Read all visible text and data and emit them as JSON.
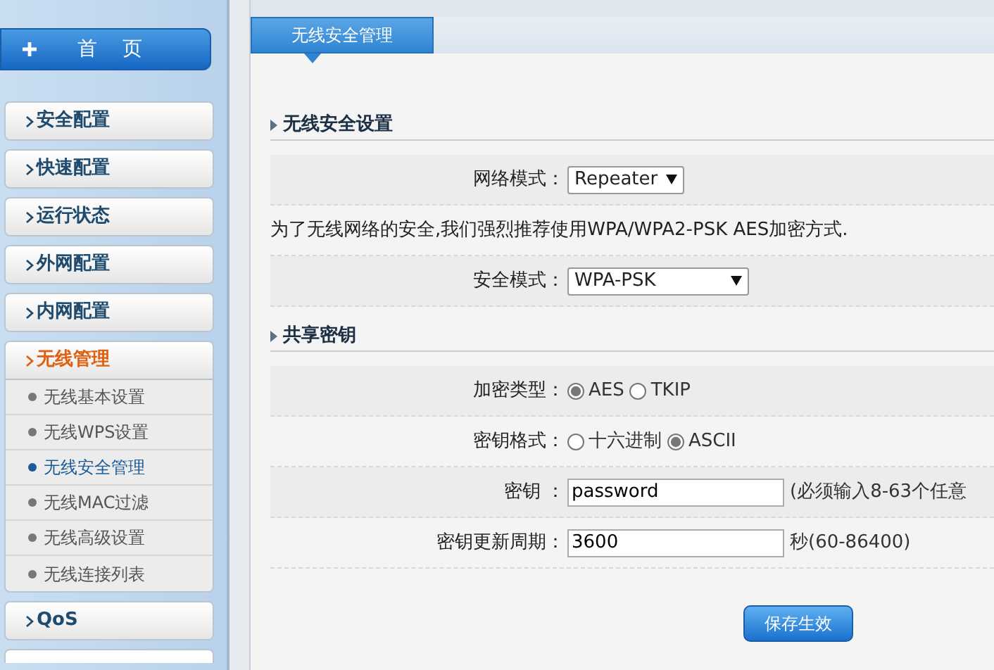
{
  "home_button": {
    "label": "首　页"
  },
  "sidebar": {
    "items": [
      {
        "label": "安全配置",
        "selected": false,
        "expanded": false
      },
      {
        "label": "快速配置",
        "selected": false,
        "expanded": false
      },
      {
        "label": "运行状态",
        "selected": false,
        "expanded": false
      },
      {
        "label": "外网配置",
        "selected": false,
        "expanded": false
      },
      {
        "label": "内网配置",
        "selected": false,
        "expanded": false
      },
      {
        "label": "无线管理",
        "selected": true,
        "expanded": true,
        "children": [
          {
            "label": "无线基本设置",
            "selected": false
          },
          {
            "label": "无线WPS设置",
            "selected": false
          },
          {
            "label": "无线安全管理",
            "selected": true
          },
          {
            "label": "无线MAC过滤",
            "selected": false
          },
          {
            "label": "无线高级设置",
            "selected": false
          },
          {
            "label": "无线连接列表",
            "selected": false
          }
        ]
      },
      {
        "label": "QoS",
        "selected": false,
        "expanded": false
      }
    ]
  },
  "tabs": [
    {
      "label": "无线安全管理",
      "selected": true
    }
  ],
  "sections": [
    {
      "title": "无线安全设置",
      "rows": [
        {
          "kind": "select",
          "label": "网络模式：",
          "value": "Repeater"
        },
        {
          "kind": "note",
          "text": "为了无线网络的安全,我们强烈推荐使用WPA/WPA2-PSK AES加密方式."
        },
        {
          "kind": "select",
          "label": "安全模式：",
          "value": "WPA-PSK"
        }
      ]
    },
    {
      "title": "共享密钥",
      "rows": [
        {
          "kind": "radio",
          "label": "加密类型：",
          "options": [
            {
              "label": "AES",
              "checked": true
            },
            {
              "label": "TKIP",
              "checked": false
            }
          ]
        },
        {
          "kind": "radio",
          "label": "密钥格式：",
          "options": [
            {
              "label": "十六进制",
              "checked": false
            },
            {
              "label": "ASCII",
              "checked": true
            }
          ]
        },
        {
          "kind": "text",
          "label": "密钥 ：",
          "value": "password",
          "hint": "(必须输入8-63个任意"
        },
        {
          "kind": "text",
          "label": "密钥更新周期：",
          "value": "3600",
          "hint": "秒(60-86400)"
        }
      ]
    }
  ],
  "save_button": {
    "label": "保存生效"
  }
}
